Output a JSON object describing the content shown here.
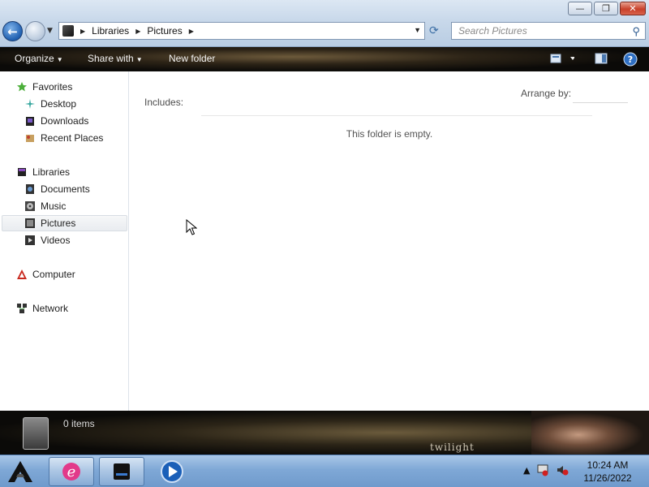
{
  "window": {
    "minimize_glyph": "—",
    "maximize_glyph": "❐",
    "close_glyph": "✕"
  },
  "address": {
    "crumbs": [
      "Libraries",
      "Pictures"
    ]
  },
  "search": {
    "placeholder": "Search Pictures"
  },
  "toolbar": {
    "organize": "Organize",
    "share_with": "Share with",
    "new_folder": "New folder"
  },
  "nav": {
    "favorites": "Favorites",
    "desktop": "Desktop",
    "downloads": "Downloads",
    "recent_places": "Recent Places",
    "libraries": "Libraries",
    "documents": "Documents",
    "music": "Music",
    "pictures": "Pictures",
    "videos": "Videos",
    "computer": "Computer",
    "network": "Network"
  },
  "content": {
    "includes_label": "Includes:",
    "arrange_by_label": "Arrange by:",
    "empty_message": "This folder is empty."
  },
  "details": {
    "item_count": "0 items",
    "brand_text": "twilight"
  },
  "taskbar": {
    "time": "10:24 AM",
    "date": "11/26/2022"
  },
  "colors": {
    "accent": "#2d5b91",
    "toolbar_bg": "#1a1510",
    "taskbar_bg": "#7fa8d6"
  }
}
